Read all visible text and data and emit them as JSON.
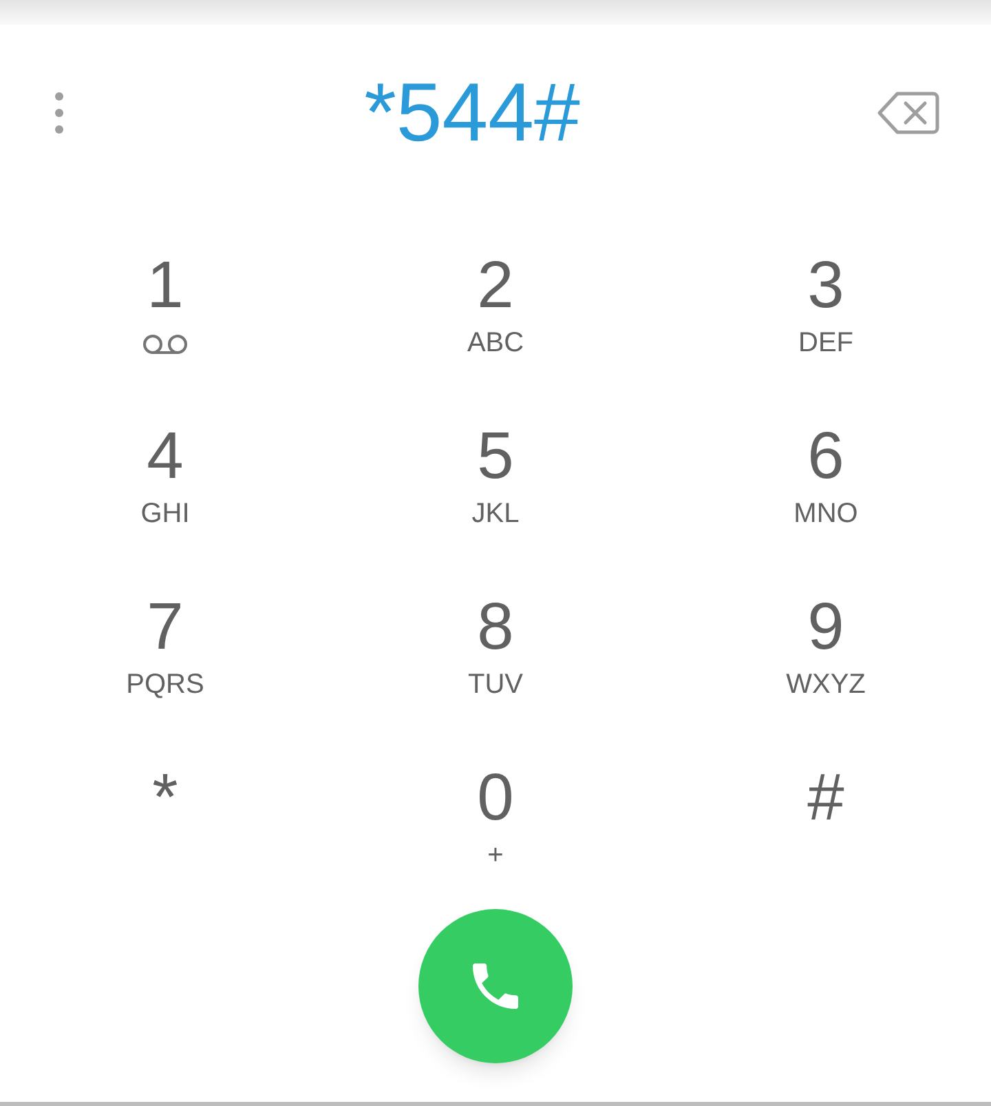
{
  "display": {
    "number": "*544#"
  },
  "keys": [
    {
      "digit": "1",
      "kind": "voicemail"
    },
    {
      "digit": "2",
      "letters": "ABC",
      "kind": "letters"
    },
    {
      "digit": "3",
      "letters": "DEF",
      "kind": "letters"
    },
    {
      "digit": "4",
      "letters": "GHI",
      "kind": "letters"
    },
    {
      "digit": "5",
      "letters": "JKL",
      "kind": "letters"
    },
    {
      "digit": "6",
      "letters": "MNO",
      "kind": "letters"
    },
    {
      "digit": "7",
      "letters": "PQRS",
      "kind": "letters"
    },
    {
      "digit": "8",
      "letters": "TUV",
      "kind": "letters"
    },
    {
      "digit": "9",
      "letters": "WXYZ",
      "kind": "letters"
    },
    {
      "digit": "*",
      "kind": "plain"
    },
    {
      "digit": "0",
      "letters": "+",
      "kind": "letters"
    },
    {
      "digit": "#",
      "kind": "plain"
    }
  ]
}
